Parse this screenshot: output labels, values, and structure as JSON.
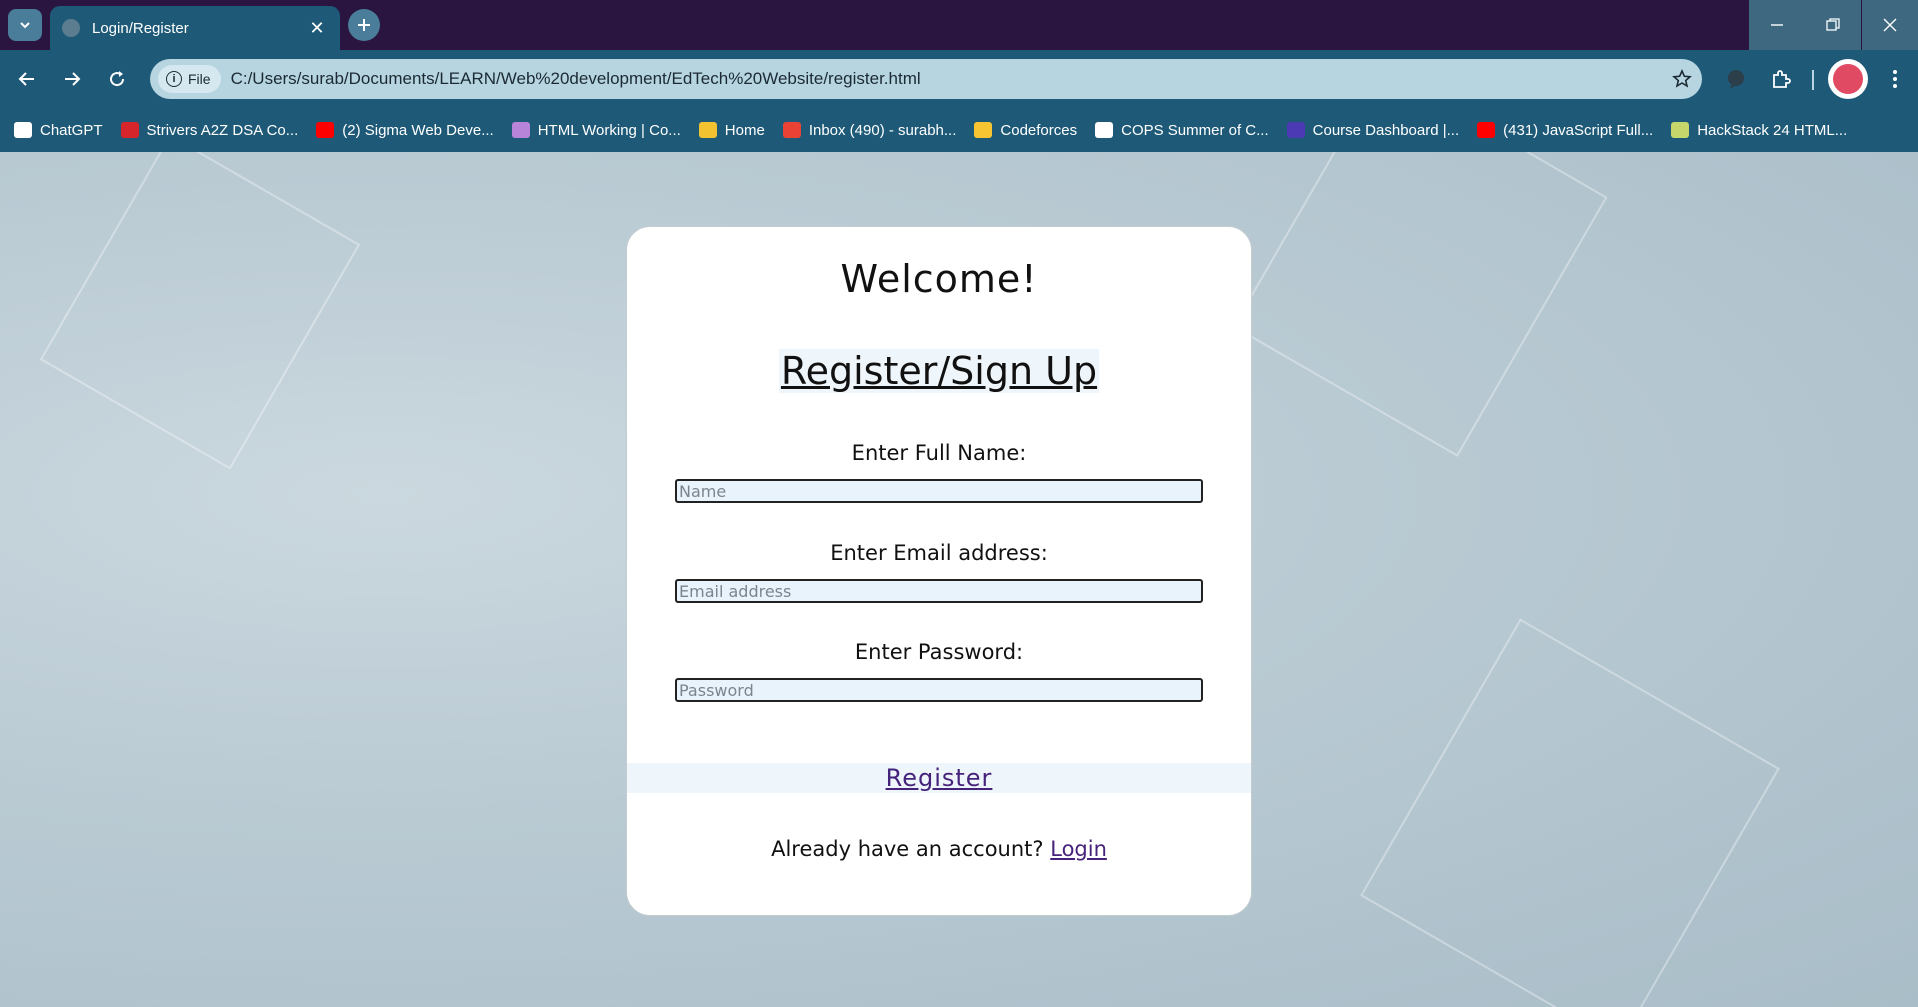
{
  "browser": {
    "tab": {
      "title": "Login/Register"
    },
    "address": {
      "chip_label": "File",
      "url": "C:/Users/surab/Documents/LEARN/Web%20development/EdTech%20Website/register.html"
    },
    "bookmarks": [
      {
        "label": "ChatGPT",
        "icon": "chatgpt-icon",
        "color": "#ffffff"
      },
      {
        "label": "Strivers A2Z DSA Co...",
        "icon": "tuf-icon",
        "color": "#d6262b"
      },
      {
        "label": "(2) Sigma Web Deve...",
        "icon": "youtube-icon",
        "color": "#ff0000"
      },
      {
        "label": "HTML Working | Co...",
        "icon": "globe-icon",
        "color": "#b784d9"
      },
      {
        "label": "Home",
        "icon": "home-icon",
        "color": "#f2c230"
      },
      {
        "label": "Inbox (490) - surabh...",
        "icon": "gmail-icon",
        "color": "#ea4335"
      },
      {
        "label": "Codeforces",
        "icon": "codeforces-icon",
        "color": "#f7c531"
      },
      {
        "label": "COPS Summer of C...",
        "icon": "cops-icon",
        "color": "#ffffff"
      },
      {
        "label": "Course Dashboard |...",
        "icon": "course-icon",
        "color": "#4b3ab3"
      },
      {
        "label": "(431) JavaScript Full...",
        "icon": "youtube-icon",
        "color": "#ff0000"
      },
      {
        "label": "HackStack 24 HTML...",
        "icon": "hackstack-icon",
        "color": "#c7d66a"
      }
    ]
  },
  "page": {
    "welcome": "Welcome!",
    "heading": "Register/Sign Up",
    "name_label": "Enter Full Name:",
    "name_placeholder": "Name",
    "email_label": "Enter Email address:",
    "email_placeholder": "Email address",
    "password_label": "Enter Password:",
    "password_placeholder": "Password",
    "register_label": "Register",
    "account_prompt": "Already have an account?",
    "login_label": "Login"
  },
  "colors": {
    "tabbar": "#2a1440",
    "toolbar": "#1e5a78",
    "link": "#46237a"
  }
}
